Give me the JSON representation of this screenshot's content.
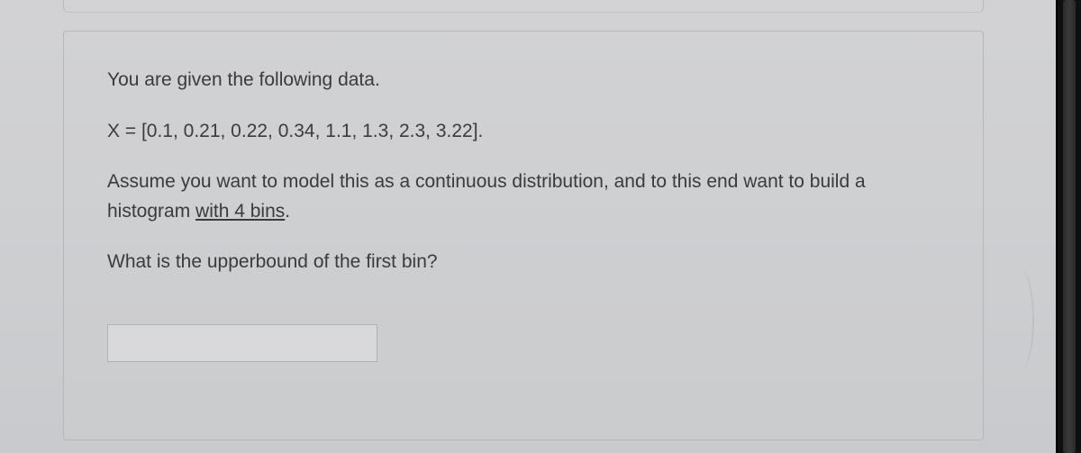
{
  "question": {
    "intro": "You are given the following data.",
    "data_line": "X = [0.1, 0.21, 0.22, 0.34, 1.1, 1.3, 2.3, 3.22].",
    "assume_pre": "Assume you want to model this as a continuous distribution, and to this end want to build a histogram ",
    "assume_underlined": "with 4 bins",
    "assume_post": ".",
    "prompt": "What is the upperbound of the first bin?"
  },
  "answer": {
    "placeholder": ""
  }
}
